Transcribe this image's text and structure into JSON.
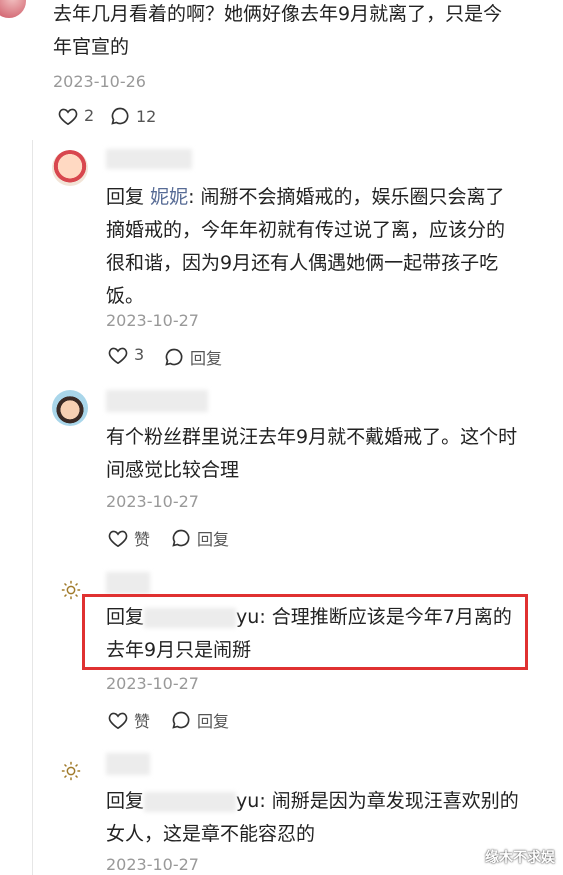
{
  "top_comment": {
    "text_line1": "去年几月看着的啊？她俩好像去年9月就离了，只是今",
    "text_line2": "年官宣的",
    "date": "2023-10-26",
    "likes": "2",
    "replies": "12"
  },
  "reply1": {
    "reply_prefix": "回复",
    "reply_to": "妮妮",
    "line1": ": 闹掰不会摘婚戒的，娱乐圈只会离了",
    "line2": "摘婚戒的，今年年初就有传过说了离，应该分的",
    "line3": "很和谐，因为9月还有人偶遇她俩一起带孩子吃",
    "line4": "饭。",
    "date": "2023-10-27",
    "likes": "3",
    "reply_label": "回复"
  },
  "reply2": {
    "line1": "有个粉丝群里说汪去年9月就不戴婚戒了。这个时",
    "line2": "间感觉比较合理",
    "date": "2023-10-27",
    "like_label": "赞",
    "reply_label": "回复"
  },
  "reply3": {
    "reply_prefix": "回复",
    "reply_to_suffix": "yu",
    "line1": ": 合理推断应该是今年7月离的",
    "line2": "去年9月只是闹掰",
    "date": "2023-10-27",
    "like_label": "赞",
    "reply_label": "回复"
  },
  "reply4": {
    "reply_prefix": "回复",
    "reply_to_suffix": "yu",
    "line1": ": 闹掰是因为章发现汪喜欢别的",
    "line2": "女人，这是章不能容忍的",
    "date": "2023-10-27"
  },
  "watermark": "缘木不求娱",
  "colors": {
    "highlight": "#e03131",
    "link": "#576b95"
  }
}
